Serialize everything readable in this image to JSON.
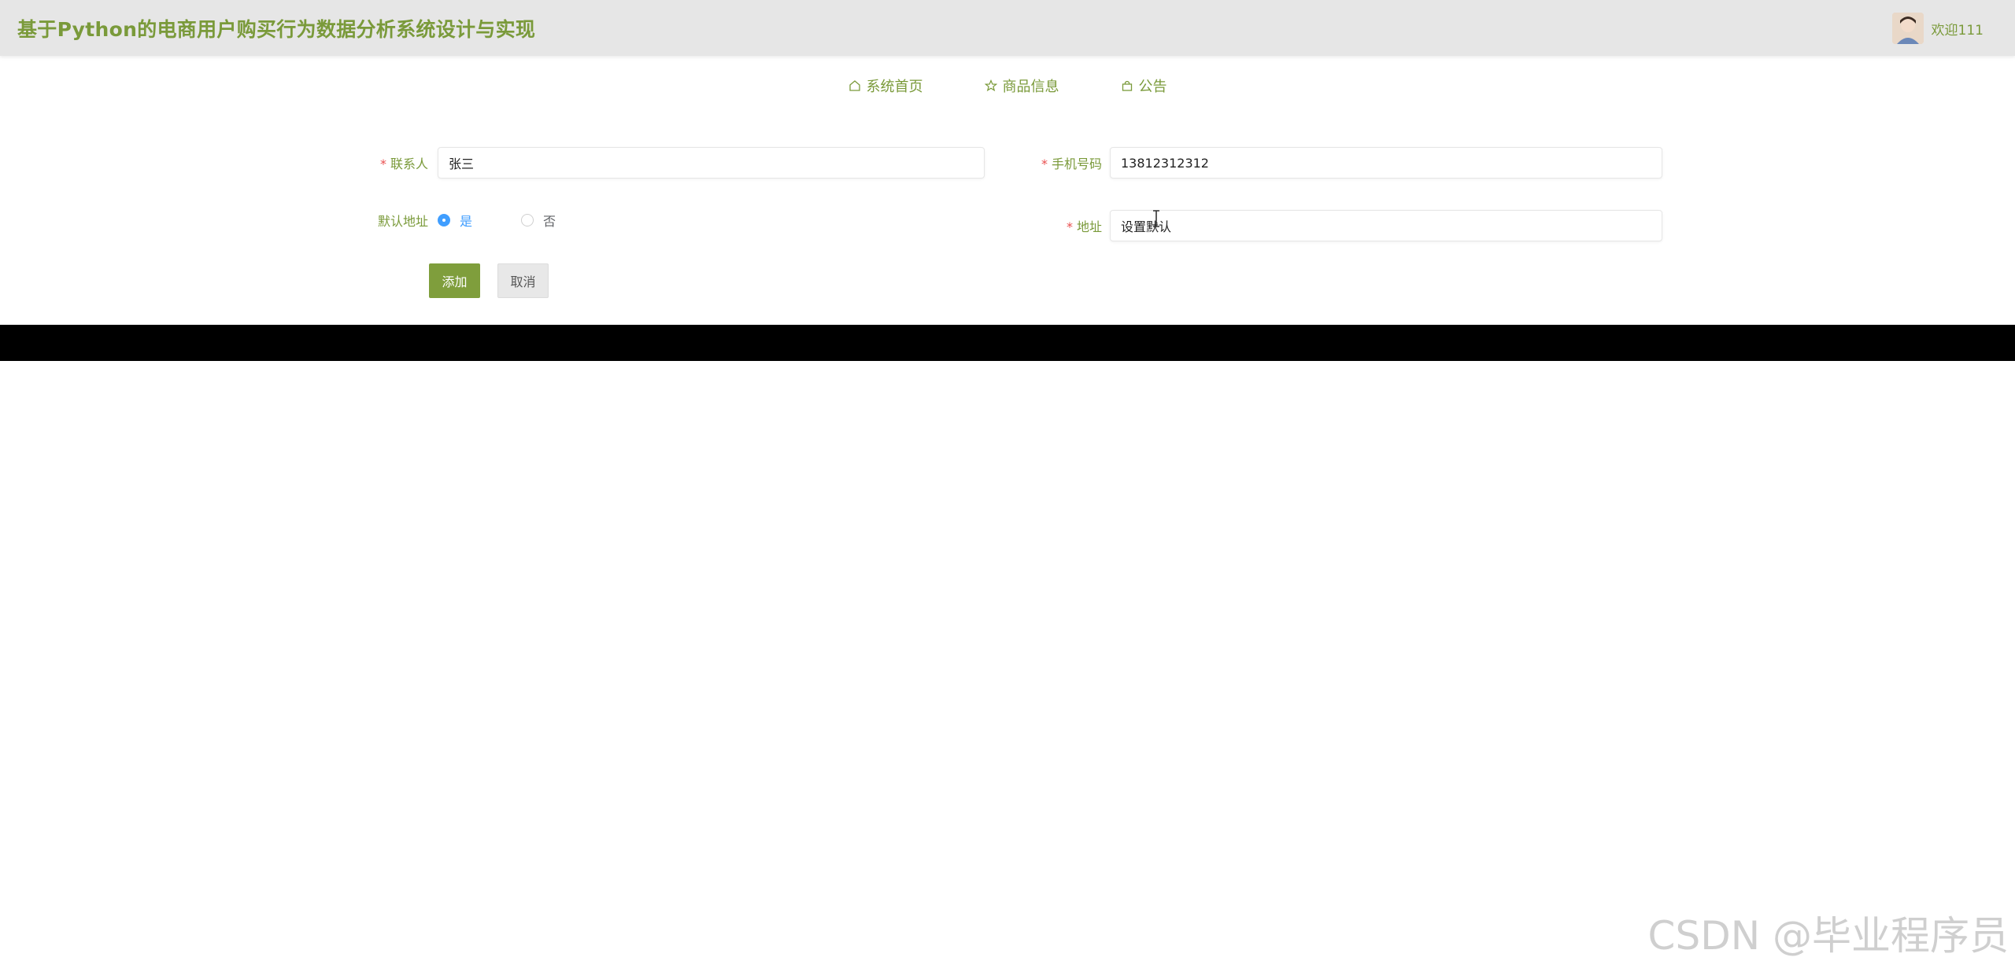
{
  "header": {
    "title": "基于Python的电商用户购买行为数据分析系统设计与实现",
    "welcome": "欢迎111"
  },
  "nav": [
    {
      "label": "系统首页",
      "icon": "home-icon"
    },
    {
      "label": "商品信息",
      "icon": "star-icon"
    },
    {
      "label": "公告",
      "icon": "bag-icon"
    }
  ],
  "form": {
    "contact": {
      "label": "联系人",
      "value": "张三",
      "required": "*"
    },
    "phone": {
      "label": "手机号码",
      "value": "13812312312",
      "required": "*"
    },
    "default_address": {
      "label": "默认地址",
      "options": [
        "是",
        "否"
      ],
      "selected": "是"
    },
    "address": {
      "label": "地址",
      "value": "设置默认",
      "required": "*"
    }
  },
  "buttons": {
    "add": "添加",
    "cancel": "取消"
  },
  "watermark": "CSDN @毕业程序员",
  "colors": {
    "accent": "#7a9a3a",
    "radio_active": "#409eff"
  }
}
